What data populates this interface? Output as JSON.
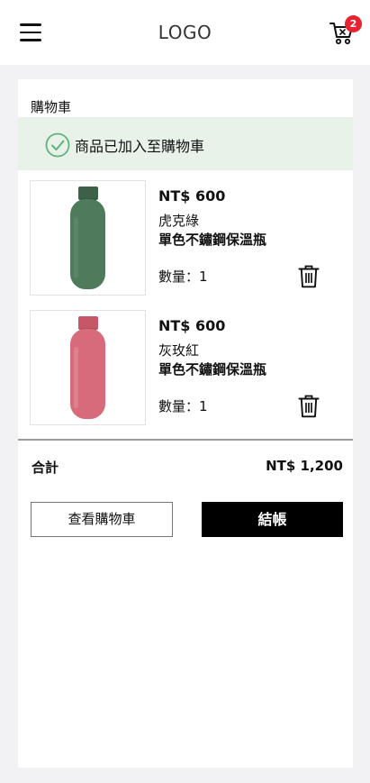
{
  "header": {
    "logo": "LOGO",
    "cart_count": "2",
    "icons": {
      "menu": "hamburger-menu-icon",
      "cart": "shopping-cart-icon"
    }
  },
  "cart": {
    "title": "購物車",
    "notice": "商品已加入至購物車",
    "items": [
      {
        "price": "NT$ 600",
        "variant": "虎克綠",
        "name": "單色不鏽鋼保溫瓶",
        "quantity": "數量：1",
        "bottle_color": "#4f7a5b"
      },
      {
        "price": "NT$ 600",
        "variant": "灰玫紅",
        "name": "單色不鏽鋼保溫瓶",
        "quantity": "數量：1",
        "bottle_color": "#d86b7b"
      }
    ],
    "total_label": "合計",
    "total_value": "NT$ 1,200",
    "view_cart_label": "查看購物車",
    "checkout_label": "結帳"
  },
  "colors": {
    "notice_bg": "#e8f2e9",
    "check_green": "#5fb37c",
    "badge_red": "#e8232f",
    "checkout_bg": "#000000"
  }
}
